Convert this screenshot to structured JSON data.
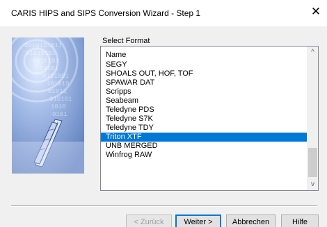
{
  "window": {
    "title": "CARIS HIPS and SIPS Conversion Wizard - Step 1",
    "close_glyph": "✕"
  },
  "format": {
    "group_label": "Select Format",
    "column_header": "Name",
    "items": [
      "SEGY",
      "SHOALS OUT, HOF, TOF",
      "SPAWAR DAT",
      "Scripps",
      "Seabeam",
      "Teledyne PDS",
      "Teledyne S7K",
      "Teledyne TDY",
      "Triton XTF",
      "UNB MERGED",
      "Winfrog RAW"
    ],
    "selected": "Triton XTF"
  },
  "scrollbar": {
    "up_glyph": "^",
    "down_glyph": "v"
  },
  "buttons": {
    "back": "< Zurück",
    "next": "Weiter >",
    "cancel": "Abbrechen",
    "help": "Hilfe"
  },
  "icons": {
    "close": "close-icon",
    "scroll_up": "chevron-up-icon",
    "scroll_down": "chevron-down-icon"
  },
  "colors": {
    "selection": "#0078d7",
    "dialog_bg": "#f0f0f0",
    "art_blue": "#6f8fc6"
  }
}
